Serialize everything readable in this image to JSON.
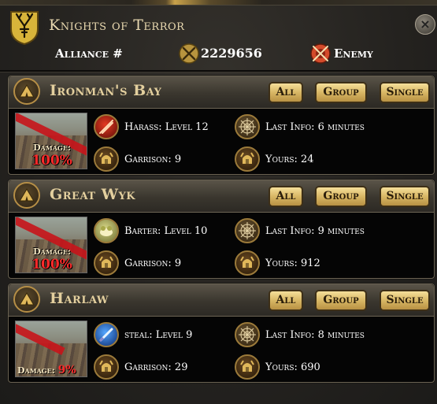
{
  "header": {
    "title": "Knights of Terror",
    "alliance_label": "Alliance #",
    "alliance_value": "2229656",
    "enemy_label": "Enemy",
    "close_glyph": "×"
  },
  "icons": {
    "crest": "stag-crest-icon",
    "alliance": "crossed-swords-icon",
    "enemy": "enemy-shield-icon",
    "location": "tent-icon",
    "garrison": "helmet-icon",
    "last_info": "spider-web-icon"
  },
  "filters": {
    "all": "All",
    "group": "Group",
    "single": "Single"
  },
  "colors": {
    "accent_gold": "#e3cf9e",
    "damage_red": "#ff2a2a",
    "button_gold": "#d8b765"
  },
  "locations": [
    {
      "name": "Ironman's Bay",
      "action": "Harass: Level 12",
      "action_icon": "harass-icon",
      "last_info": "Last Info: 6 minutes",
      "garrison": "Garrison: 9",
      "yours": "Yours: 24",
      "damage_label": "Damage:",
      "damage_value": "100%"
    },
    {
      "name": "Great Wyk",
      "action": "Barter: Level 10",
      "action_icon": "barter-icon",
      "last_info": "Last Info: 9 minutes",
      "garrison": "Garrison: 9",
      "yours": "Yours: 912",
      "damage_label": "Damage:",
      "damage_value": "100%"
    },
    {
      "name": "Harlaw",
      "action": "steal: Level 9",
      "action_icon": "steal-icon",
      "last_info": "Last Info: 8 minutes",
      "garrison": "Garrison: 29",
      "yours": "Yours: 690",
      "damage_label": "Damage:",
      "damage_value": "9%"
    }
  ]
}
